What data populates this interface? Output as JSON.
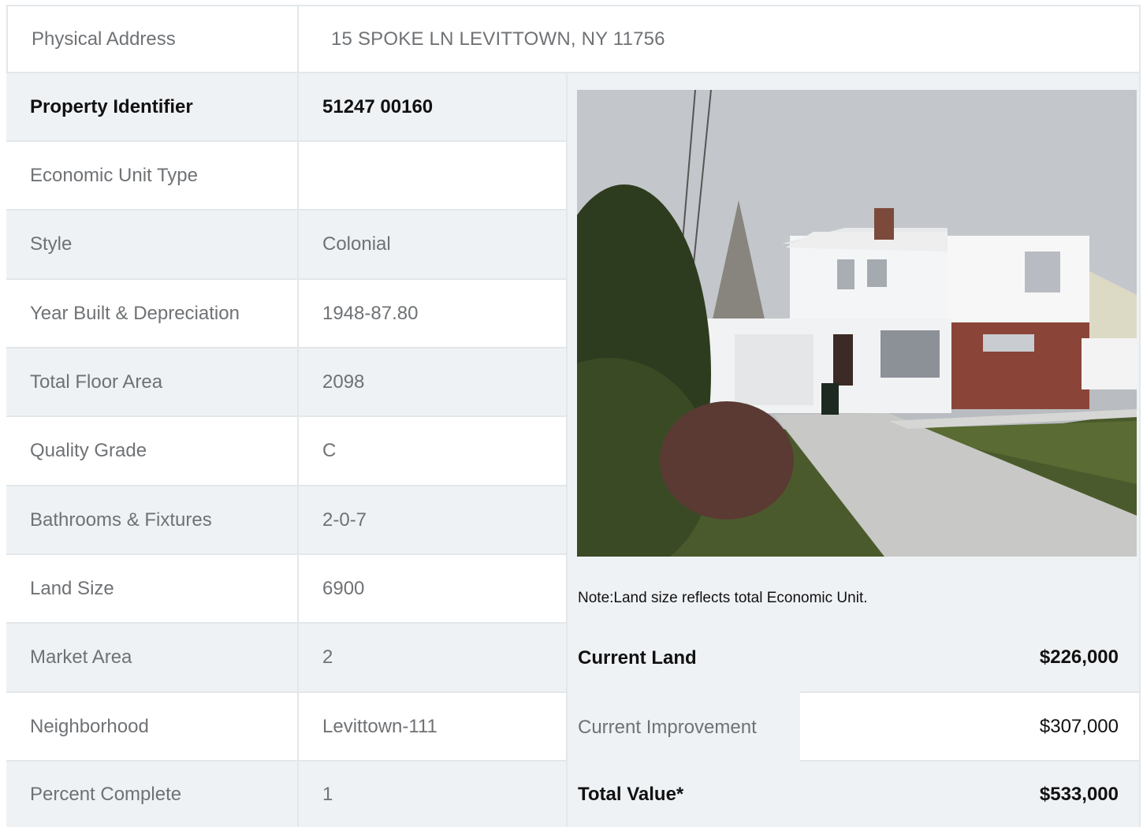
{
  "address": {
    "label": "Physical Address",
    "value": "15  SPOKE LN  LEVITTOWN, NY  11756"
  },
  "rows": [
    {
      "label": "Property Identifier",
      "value": "51247  00160"
    },
    {
      "label": "Economic Unit Type",
      "value": ""
    },
    {
      "label": "Style",
      "value": "Colonial"
    },
    {
      "label": "Year Built & Depreciation",
      "value": "1948-87.80"
    },
    {
      "label": "Total Floor Area",
      "value": "2098"
    },
    {
      "label": "Quality Grade",
      "value": "C"
    },
    {
      "label": "Bathrooms & Fixtures",
      "value": "2-0-7"
    },
    {
      "label": "Land Size",
      "value": "6900"
    },
    {
      "label": "Market Area",
      "value": "2"
    },
    {
      "label": "Neighborhood",
      "value": "Levittown-111"
    },
    {
      "label": "Percent Complete",
      "value": "1"
    }
  ],
  "note": "Note:Land size reflects total Economic Unit.",
  "valuation": [
    {
      "label": "Current Land",
      "value": "$226,000"
    },
    {
      "label": "Current Improvement",
      "value": "$307,000"
    },
    {
      "label": "Total Value*",
      "value": "$533,000"
    }
  ],
  "colors": {
    "border": "#e3e7ea",
    "shade": "#eff2f5",
    "muted_text": "#6f7275",
    "strong_text": "#111111"
  }
}
